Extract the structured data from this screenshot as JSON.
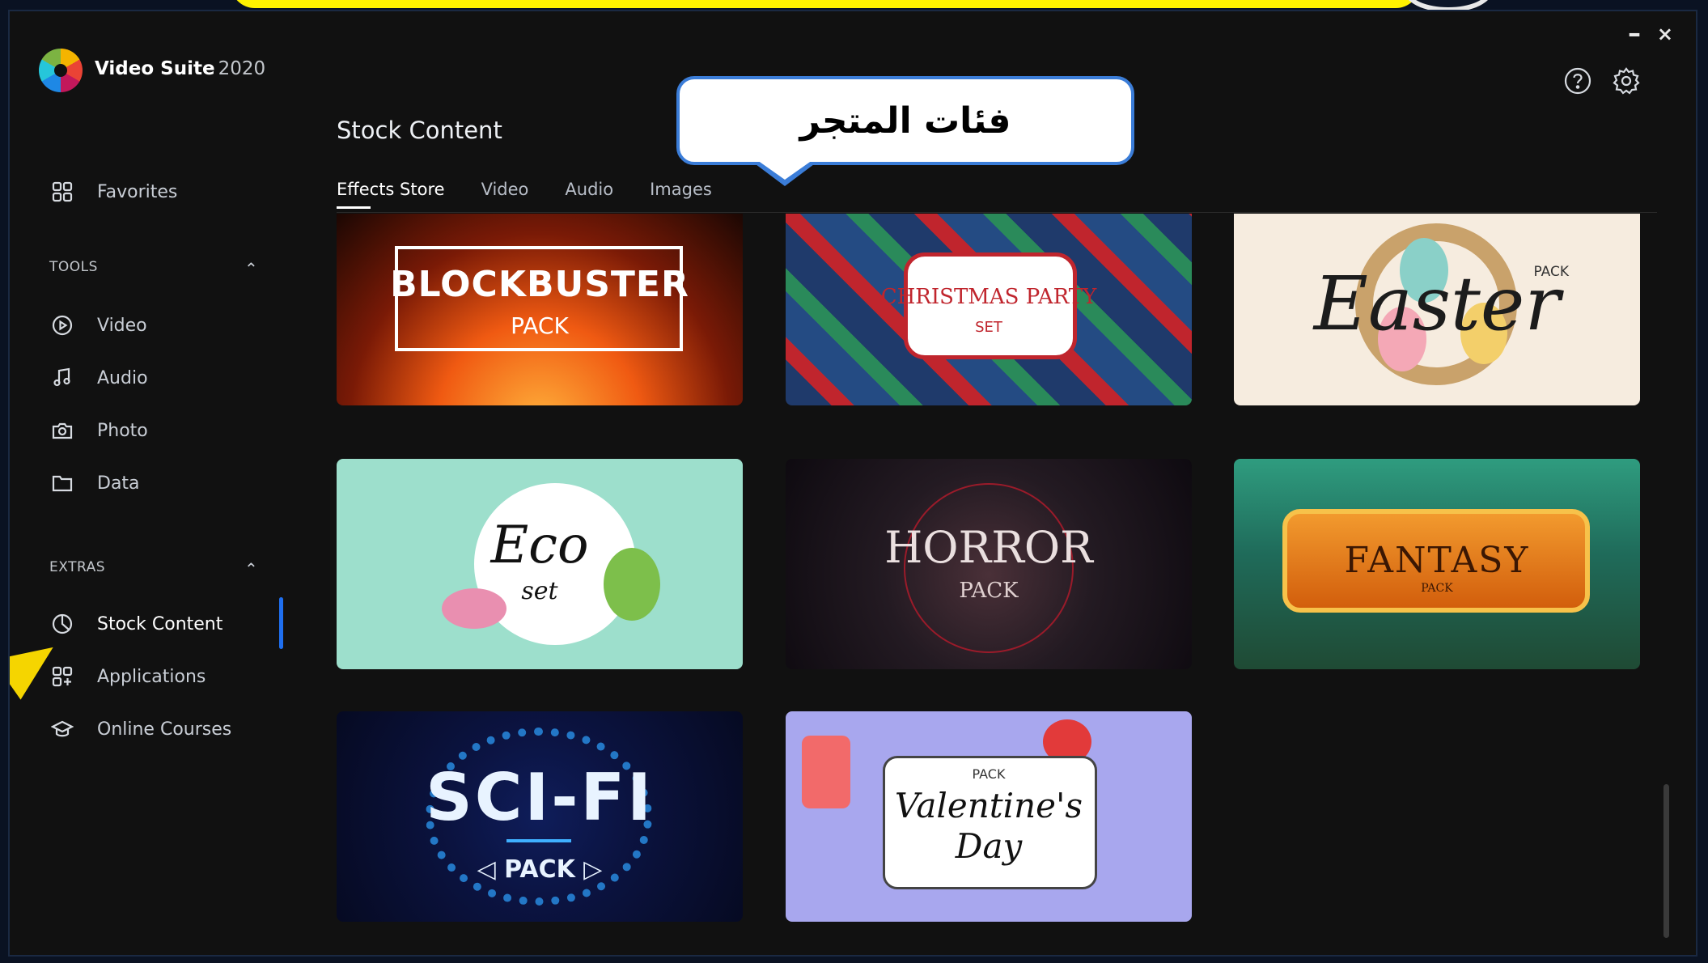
{
  "app": {
    "name": "Video Suite",
    "year": "2020"
  },
  "window_controls": {
    "minimize": "–",
    "close": "×"
  },
  "sidebar": {
    "favorites": "Favorites",
    "tools_section": {
      "title": "TOOLS",
      "toggle": "⌃"
    },
    "tools": [
      {
        "label": "Video",
        "icon": "play-circle-icon"
      },
      {
        "label": "Audio",
        "icon": "music-note-icon"
      },
      {
        "label": "Photo",
        "icon": "camera-icon"
      },
      {
        "label": "Data",
        "icon": "folder-icon"
      }
    ],
    "extras_section": {
      "title": "EXTRAS",
      "toggle": "⌃"
    },
    "extras": [
      {
        "label": "Stock Content",
        "icon": "pie-chart-icon",
        "active": true
      },
      {
        "label": "Applications",
        "icon": "apps-icon"
      },
      {
        "label": "Online Courses",
        "icon": "graduation-cap-icon"
      }
    ]
  },
  "main": {
    "title": "Stock Content",
    "tabs": [
      "Effects Store",
      "Video",
      "Audio",
      "Images"
    ],
    "active_tab": "Effects Store"
  },
  "callout": {
    "text": "فئات المتجر"
  },
  "cards": {
    "blockbuster": {
      "title": "BLOCKBUSTER",
      "subtitle": "PACK"
    },
    "christmas": {
      "title": "CHRISTMAS PARTY",
      "subtitle": "SET"
    },
    "easter": {
      "title": "Easter",
      "subtitle": "PACK"
    },
    "eco": {
      "title": "Eco",
      "subtitle": "set"
    },
    "horror": {
      "title": "HORROR",
      "subtitle": "PACK"
    },
    "fantasy": {
      "title": "FANTASY",
      "subtitle": "PACK"
    },
    "scifi": {
      "title": "SCI-FI",
      "subtitle": "◁ PACK ▷"
    },
    "valentine": {
      "pre": "PACK",
      "title": "Valentine's",
      "subtitle": "Day"
    }
  },
  "colors": {
    "accent": "#1f6ff0",
    "background": "#111111",
    "callout_border": "#3b7dd8"
  }
}
